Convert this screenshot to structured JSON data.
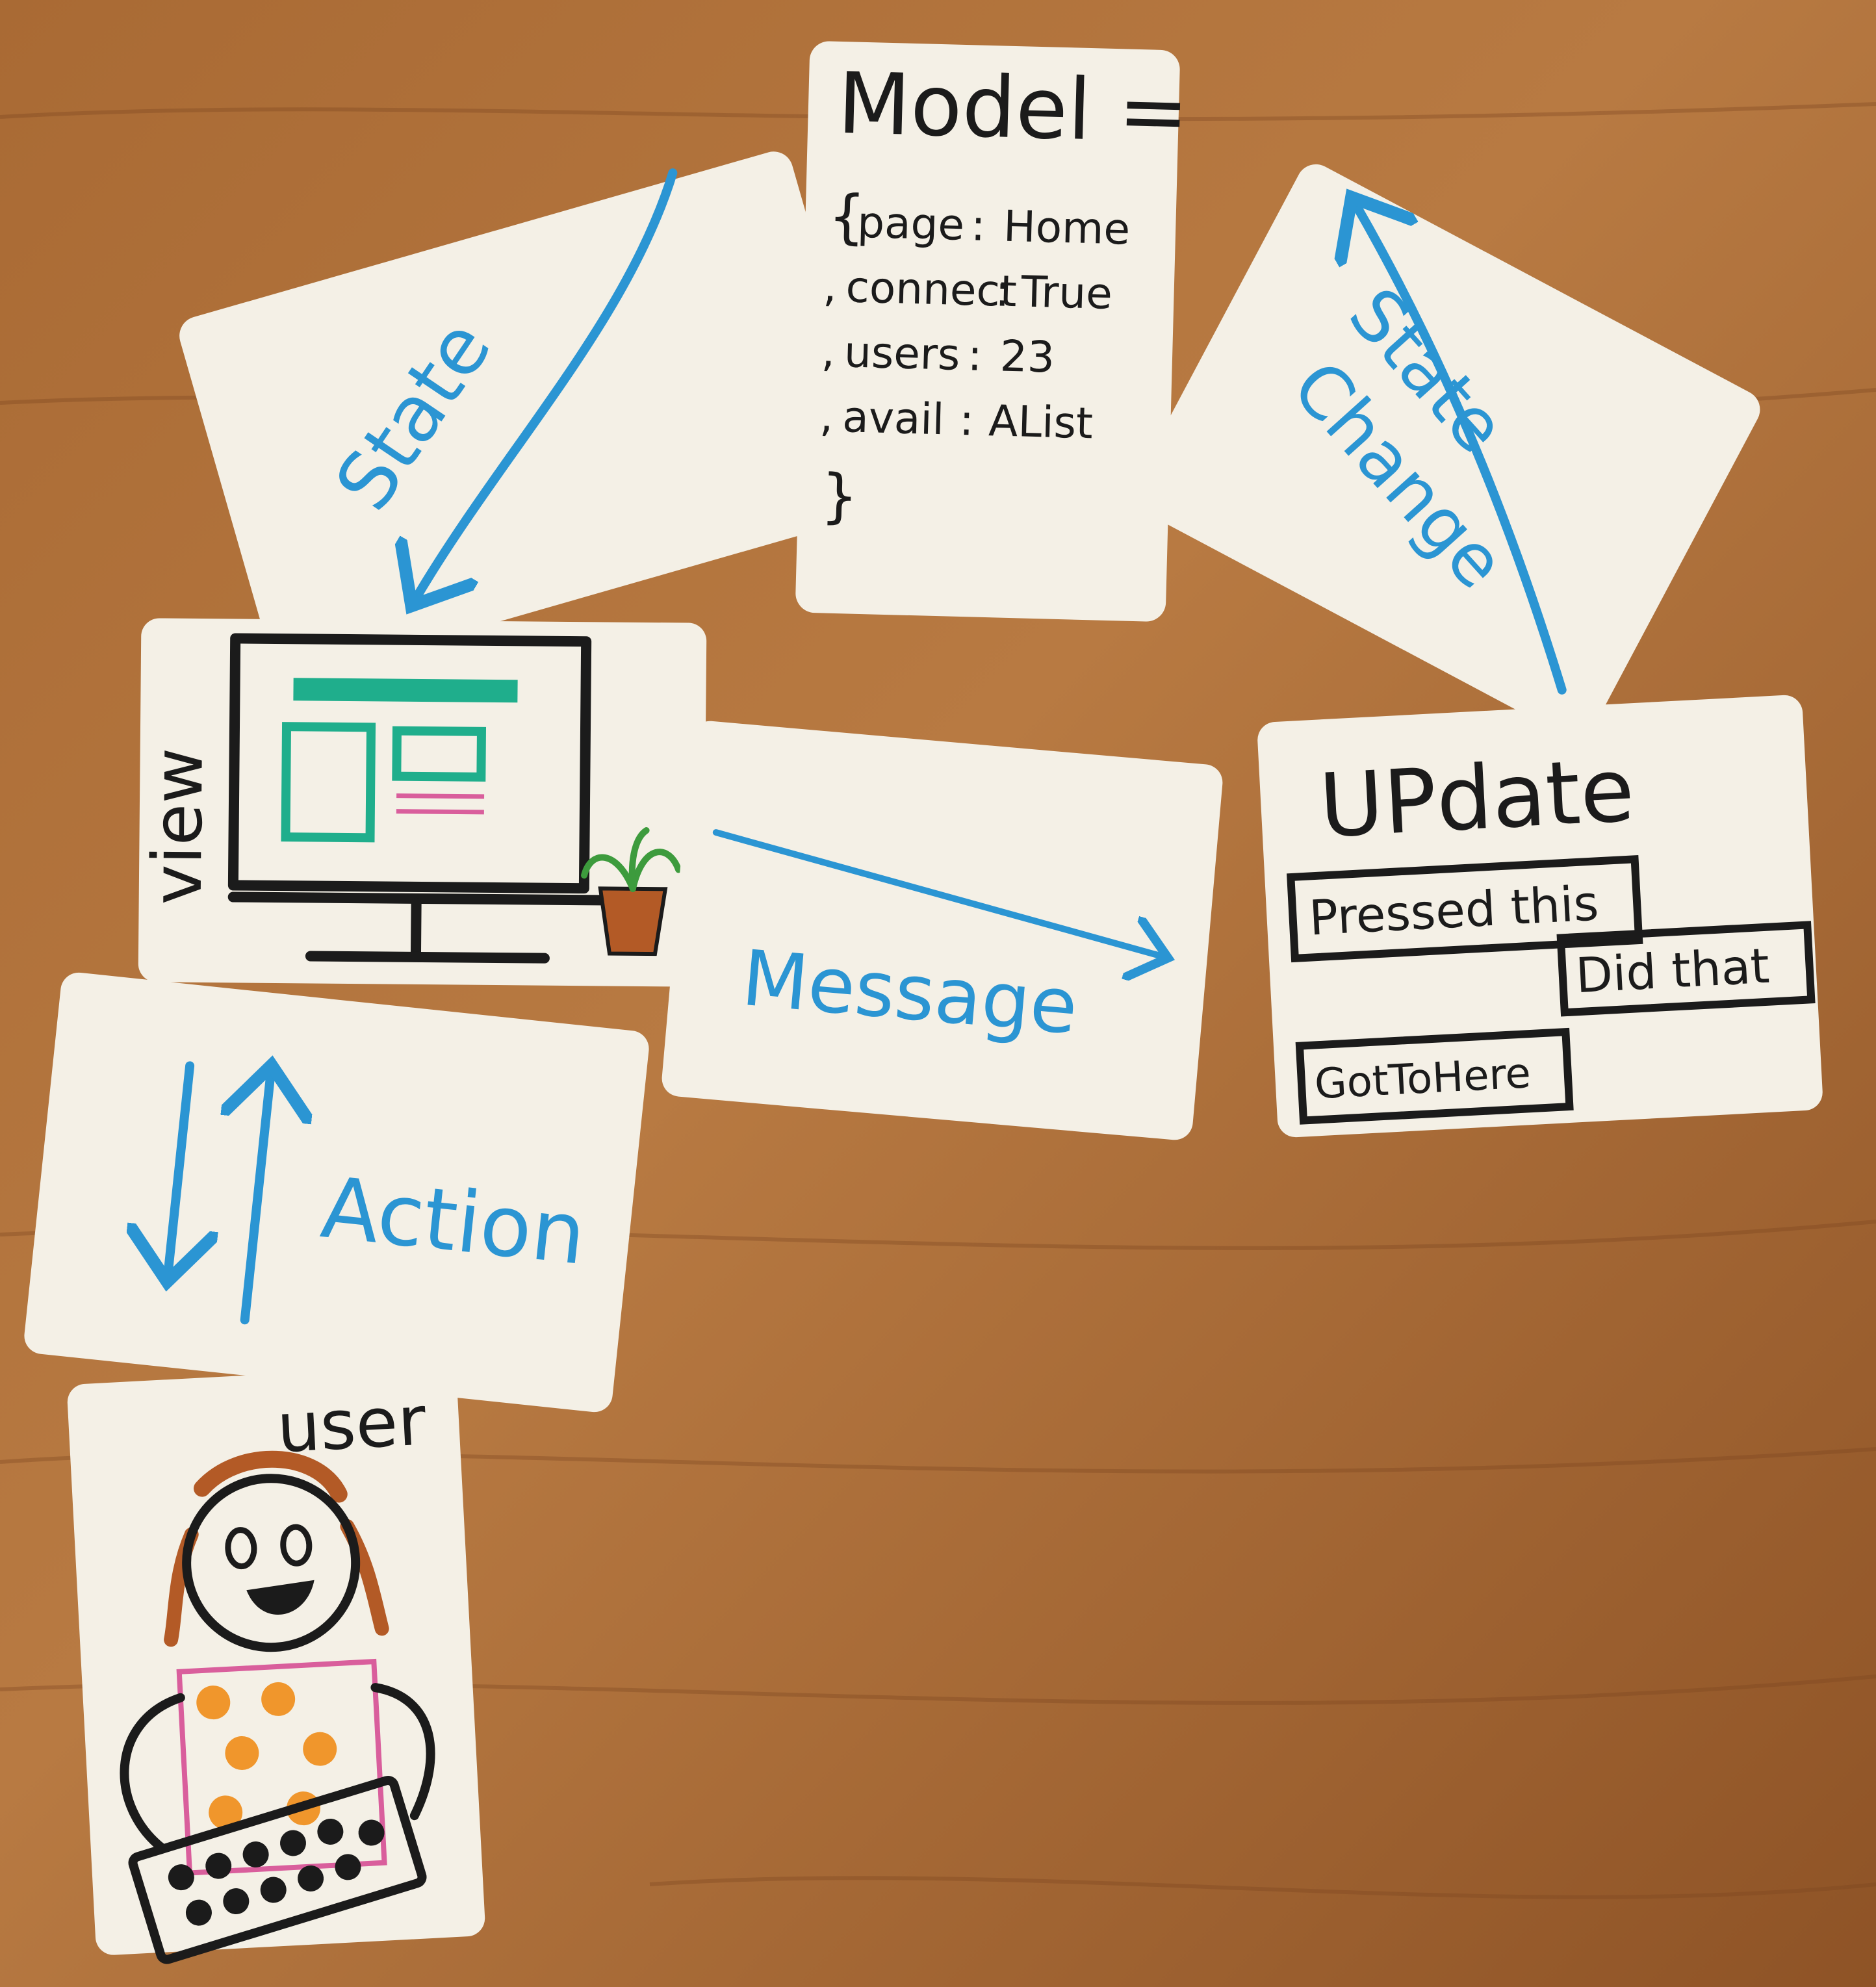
{
  "colors": {
    "wood": "#b0713a",
    "wood_dark": "#7a4620",
    "card": "#f4f0e6",
    "ink_black": "#1b1b1b",
    "ink_blue": "#2b95d3",
    "ink_teal": "#1fae8c",
    "ink_pink": "#d95e9c",
    "ink_orange": "#f0962c",
    "ink_brown": "#b35a26"
  },
  "cards": {
    "model": {
      "title": "Model =",
      "open_brace": "{",
      "close_brace": "}",
      "fields": [
        {
          "key": "page",
          "value": "Home"
        },
        {
          "key": "connect",
          "value": "True"
        },
        {
          "key": "users",
          "value": "23"
        },
        {
          "key": "avail",
          "value": "AList"
        }
      ]
    },
    "state": {
      "label": "State"
    },
    "state_change": {
      "line1": "State",
      "line2": "Change"
    },
    "view": {
      "label": "view"
    },
    "message": {
      "label": "Message"
    },
    "update": {
      "title": "UPdate",
      "boxes": [
        "Pressed this",
        "Did that",
        "GotToHere"
      ]
    },
    "action": {
      "label": "Action"
    },
    "user": {
      "label": "user"
    }
  },
  "icons": {
    "monitor": "monitor-icon",
    "plant": "potted-plant-icon",
    "keyboard": "keyboard-icon",
    "user_figure": "stick-figure-icon"
  }
}
